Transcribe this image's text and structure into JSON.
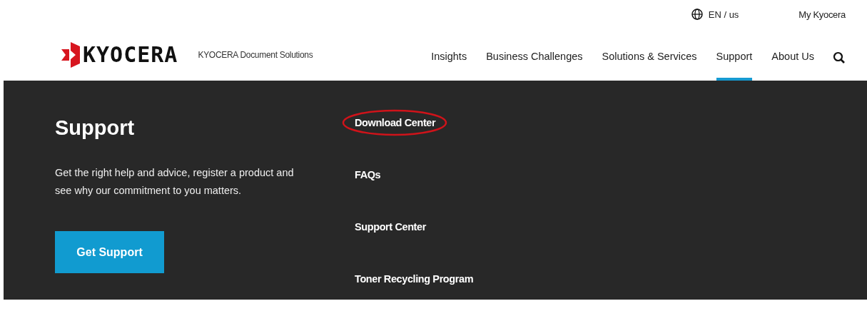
{
  "top_bar": {
    "language": "EN / us",
    "account_link": "My Kyocera"
  },
  "header": {
    "logo_text": "KYOCERA",
    "tagline": "KYOCERA Document Solutions",
    "nav": [
      {
        "label": "Insights",
        "selected": false
      },
      {
        "label": "Business Challenges",
        "selected": false
      },
      {
        "label": "Solutions & Services",
        "selected": false
      },
      {
        "label": "Support",
        "selected": true
      },
      {
        "label": "About Us",
        "selected": false
      }
    ]
  },
  "mega_menu": {
    "title": "Support",
    "description": "Get the right help and advice, register a product and see why our commitment to you matters.",
    "button": "Get Support",
    "links": [
      {
        "label": "Download Center",
        "circled": true
      },
      {
        "label": "FAQs",
        "circled": false
      },
      {
        "label": "Support Center",
        "circled": false
      },
      {
        "label": "Toner Recycling Program",
        "circled": false
      }
    ]
  }
}
